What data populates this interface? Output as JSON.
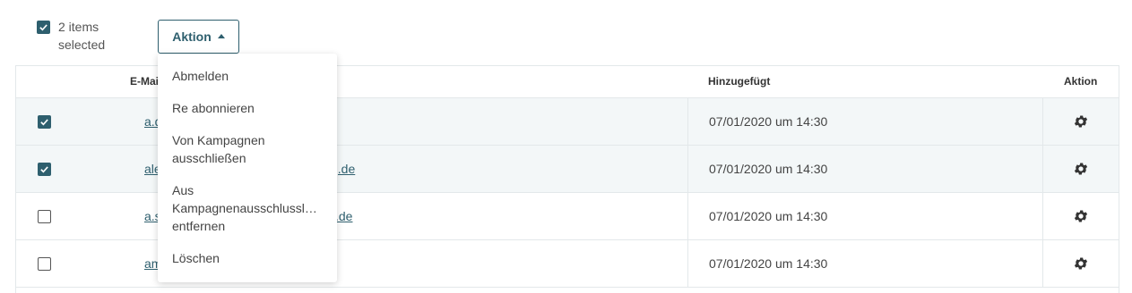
{
  "selection": {
    "count_text": "2 items selected"
  },
  "action_button": {
    "label": "Aktion"
  },
  "dropdown": {
    "items": [
      {
        "label": "Abmelden"
      },
      {
        "label": "Re abonnieren"
      },
      {
        "label": "Von Kampagnen ausschließen"
      },
      {
        "line1": "Aus",
        "line2": "Kampagnenausschlussli…",
        "line3": "entfernen"
      },
      {
        "label": "Löschen"
      }
    ]
  },
  "table": {
    "columns": {
      "email": "E-Mail",
      "added": "Hinzugefügt",
      "action": "Aktion"
    },
    "rows": [
      {
        "email_visible": "a.d",
        "added": "07/01/2020 um 14:30",
        "checked": true
      },
      {
        "email_visible_start": "ale",
        "email_visible_end": "g.de",
        "added": "07/01/2020 um 14:30",
        "checked": true
      },
      {
        "email_visible_start": "a.s",
        "email_visible_end": ".de",
        "added": "07/01/2020 um 14:30",
        "checked": false
      },
      {
        "email_visible": "am",
        "added": "07/01/2020 um 14:30",
        "checked": false
      }
    ]
  },
  "colors": {
    "accent": "#2e5f6e",
    "row_selected_bg": "#f3f7f8",
    "border": "#e3e8ea"
  },
  "icons": {
    "row_action": "gear-icon",
    "checkbox_check": "check-icon",
    "button_caret": "caret-up-icon"
  }
}
